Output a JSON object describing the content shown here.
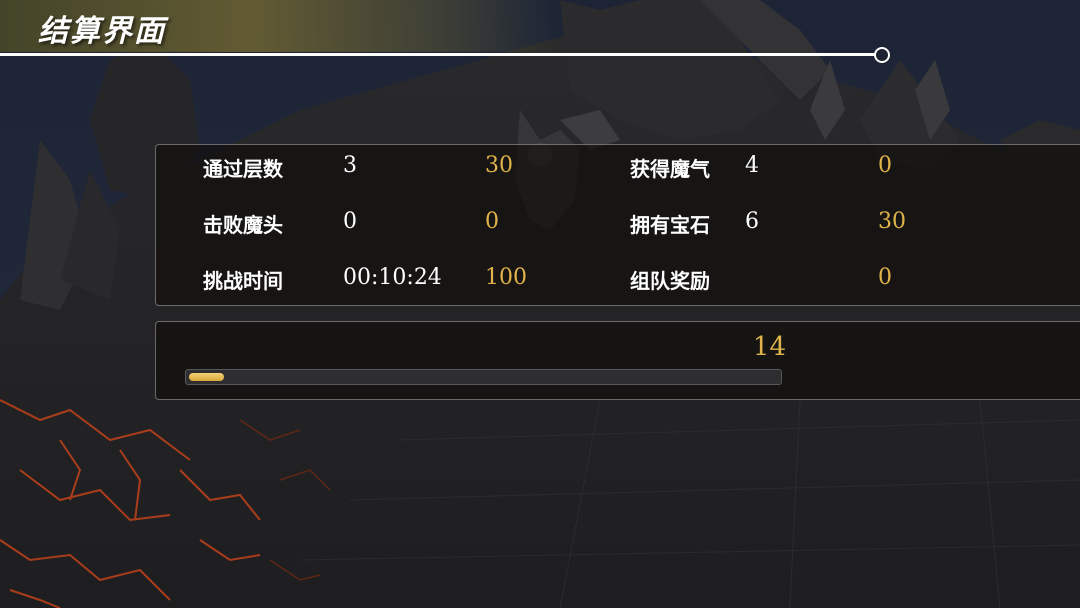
{
  "screen": {
    "title": "结算界面"
  },
  "stats": {
    "floors": {
      "label": "通过层数",
      "value": "3",
      "reward": "30"
    },
    "demons": {
      "label": "击败魔头",
      "value": "0",
      "reward": "0"
    },
    "time": {
      "label": "挑战时间",
      "value": "00:10:24",
      "reward": "100"
    },
    "qi": {
      "label": "获得魔气",
      "value": "4",
      "reward": "0"
    },
    "gems": {
      "label": "拥有宝石",
      "value": "6",
      "reward": "30"
    },
    "team": {
      "label": "组队奖励",
      "value": "",
      "reward": "0"
    }
  },
  "progress": {
    "value": "14",
    "fill_fraction": 0.06
  },
  "colors": {
    "reward_gold": "#e0b44a",
    "text_white": "#ffffff",
    "panel_border": "#b4b4b4"
  }
}
